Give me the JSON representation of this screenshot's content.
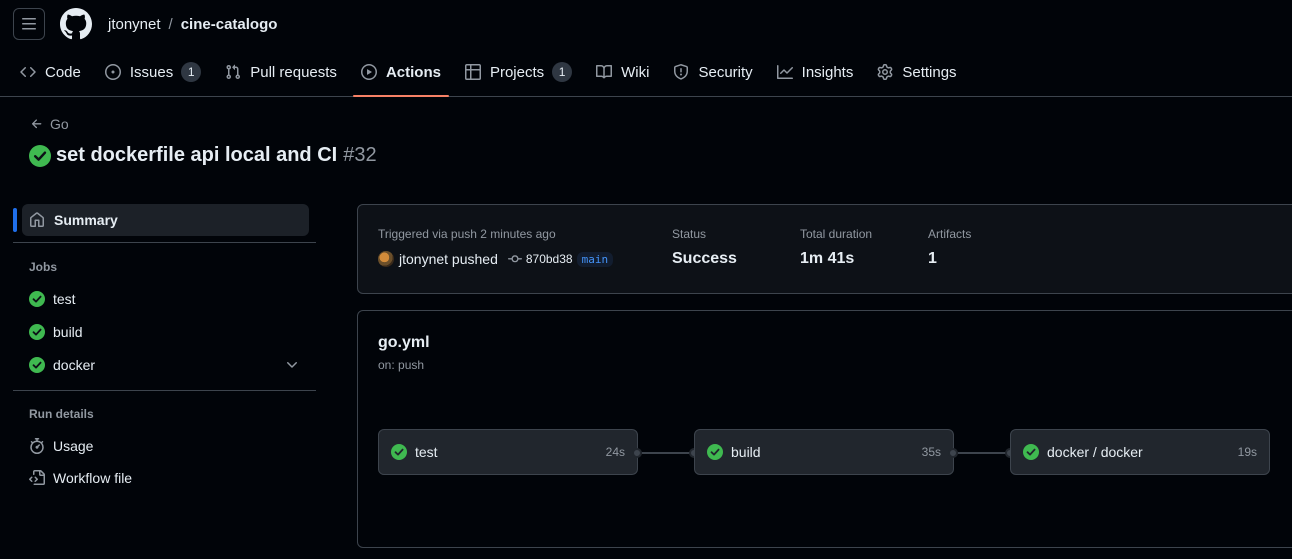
{
  "header": {
    "owner": "jtonynet",
    "separator": "/",
    "repo": "cine-catalogo"
  },
  "tabs": [
    {
      "label": "Code",
      "icon": "code-icon"
    },
    {
      "label": "Issues",
      "icon": "issue-icon",
      "count": "1"
    },
    {
      "label": "Pull requests",
      "icon": "pull-request-icon"
    },
    {
      "label": "Actions",
      "icon": "play-icon",
      "active": true
    },
    {
      "label": "Projects",
      "icon": "table-icon",
      "count": "1"
    },
    {
      "label": "Wiki",
      "icon": "book-icon"
    },
    {
      "label": "Security",
      "icon": "shield-icon"
    },
    {
      "label": "Insights",
      "icon": "graph-icon"
    },
    {
      "label": "Settings",
      "icon": "gear-icon"
    }
  ],
  "run": {
    "back_label": "Go",
    "title": "set dockerfile api local and CI",
    "number": "#32"
  },
  "sidebar": {
    "summary_label": "Summary",
    "jobs_heading": "Jobs",
    "jobs": [
      {
        "label": "test",
        "status": "success"
      },
      {
        "label": "build",
        "status": "success"
      },
      {
        "label": "docker",
        "status": "success"
      }
    ],
    "run_details_heading": "Run details",
    "details": [
      {
        "label": "Usage",
        "icon": "stopwatch-icon"
      },
      {
        "label": "Workflow file",
        "icon": "file-code-icon"
      }
    ]
  },
  "summary": {
    "triggered_label": "Triggered via push 2 minutes ago",
    "actor_text": "jtonynet pushed",
    "commit_sha": "870bd38",
    "branch": "main",
    "status_label": "Status",
    "status_value": "Success",
    "duration_label": "Total duration",
    "duration_value": "1m 41s",
    "artifacts_label": "Artifacts",
    "artifacts_value": "1"
  },
  "workflow": {
    "name": "go.yml",
    "trigger": "on: push",
    "jobs": [
      {
        "label": "test",
        "duration": "24s"
      },
      {
        "label": "build",
        "duration": "35s"
      },
      {
        "label": "docker / docker",
        "duration": "19s"
      }
    ]
  },
  "colors": {
    "background": "#010409",
    "success": "#3fb950",
    "accent_underline": "#f78166",
    "link": "#4493f8"
  }
}
